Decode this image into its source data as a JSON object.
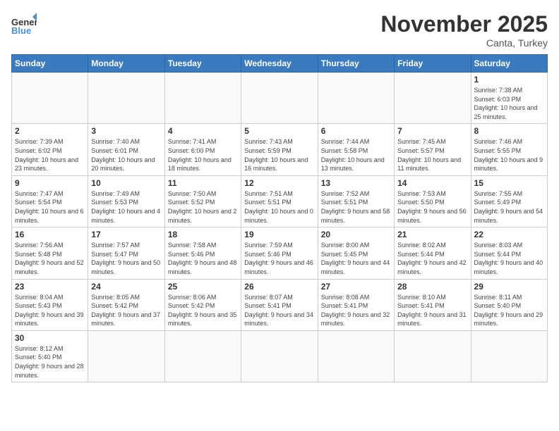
{
  "header": {
    "logo_general": "General",
    "logo_blue": "Blue",
    "month": "November 2025",
    "location": "Canta, Turkey"
  },
  "weekdays": [
    "Sunday",
    "Monday",
    "Tuesday",
    "Wednesday",
    "Thursday",
    "Friday",
    "Saturday"
  ],
  "days": {
    "1": {
      "sunrise": "7:38 AM",
      "sunset": "6:03 PM",
      "daylight": "10 hours and 25 minutes."
    },
    "2": {
      "sunrise": "7:39 AM",
      "sunset": "6:02 PM",
      "daylight": "10 hours and 23 minutes."
    },
    "3": {
      "sunrise": "7:40 AM",
      "sunset": "6:01 PM",
      "daylight": "10 hours and 20 minutes."
    },
    "4": {
      "sunrise": "7:41 AM",
      "sunset": "6:00 PM",
      "daylight": "10 hours and 18 minutes."
    },
    "5": {
      "sunrise": "7:43 AM",
      "sunset": "5:59 PM",
      "daylight": "10 hours and 16 minutes."
    },
    "6": {
      "sunrise": "7:44 AM",
      "sunset": "5:58 PM",
      "daylight": "10 hours and 13 minutes."
    },
    "7": {
      "sunrise": "7:45 AM",
      "sunset": "5:57 PM",
      "daylight": "10 hours and 11 minutes."
    },
    "8": {
      "sunrise": "7:46 AM",
      "sunset": "5:55 PM",
      "daylight": "10 hours and 9 minutes."
    },
    "9": {
      "sunrise": "7:47 AM",
      "sunset": "5:54 PM",
      "daylight": "10 hours and 6 minutes."
    },
    "10": {
      "sunrise": "7:49 AM",
      "sunset": "5:53 PM",
      "daylight": "10 hours and 4 minutes."
    },
    "11": {
      "sunrise": "7:50 AM",
      "sunset": "5:52 PM",
      "daylight": "10 hours and 2 minutes."
    },
    "12": {
      "sunrise": "7:51 AM",
      "sunset": "5:51 PM",
      "daylight": "10 hours and 0 minutes."
    },
    "13": {
      "sunrise": "7:52 AM",
      "sunset": "5:51 PM",
      "daylight": "9 hours and 58 minutes."
    },
    "14": {
      "sunrise": "7:53 AM",
      "sunset": "5:50 PM",
      "daylight": "9 hours and 56 minutes."
    },
    "15": {
      "sunrise": "7:55 AM",
      "sunset": "5:49 PM",
      "daylight": "9 hours and 54 minutes."
    },
    "16": {
      "sunrise": "7:56 AM",
      "sunset": "5:48 PM",
      "daylight": "9 hours and 52 minutes."
    },
    "17": {
      "sunrise": "7:57 AM",
      "sunset": "5:47 PM",
      "daylight": "9 hours and 50 minutes."
    },
    "18": {
      "sunrise": "7:58 AM",
      "sunset": "5:46 PM",
      "daylight": "9 hours and 48 minutes."
    },
    "19": {
      "sunrise": "7:59 AM",
      "sunset": "5:46 PM",
      "daylight": "9 hours and 46 minutes."
    },
    "20": {
      "sunrise": "8:00 AM",
      "sunset": "5:45 PM",
      "daylight": "9 hours and 44 minutes."
    },
    "21": {
      "sunrise": "8:02 AM",
      "sunset": "5:44 PM",
      "daylight": "9 hours and 42 minutes."
    },
    "22": {
      "sunrise": "8:03 AM",
      "sunset": "5:44 PM",
      "daylight": "9 hours and 40 minutes."
    },
    "23": {
      "sunrise": "8:04 AM",
      "sunset": "5:43 PM",
      "daylight": "9 hours and 39 minutes."
    },
    "24": {
      "sunrise": "8:05 AM",
      "sunset": "5:42 PM",
      "daylight": "9 hours and 37 minutes."
    },
    "25": {
      "sunrise": "8:06 AM",
      "sunset": "5:42 PM",
      "daylight": "9 hours and 35 minutes."
    },
    "26": {
      "sunrise": "8:07 AM",
      "sunset": "5:41 PM",
      "daylight": "9 hours and 34 minutes."
    },
    "27": {
      "sunrise": "8:08 AM",
      "sunset": "5:41 PM",
      "daylight": "9 hours and 32 minutes."
    },
    "28": {
      "sunrise": "8:10 AM",
      "sunset": "5:41 PM",
      "daylight": "9 hours and 31 minutes."
    },
    "29": {
      "sunrise": "8:11 AM",
      "sunset": "5:40 PM",
      "daylight": "9 hours and 29 minutes."
    },
    "30": {
      "sunrise": "8:12 AM",
      "sunset": "5:40 PM",
      "daylight": "9 hours and 28 minutes."
    }
  }
}
